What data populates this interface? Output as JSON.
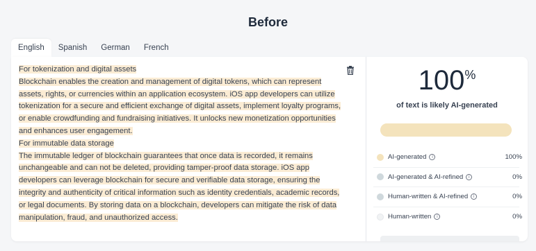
{
  "page": {
    "title": "Before"
  },
  "tabs": [
    {
      "label": "English",
      "active": true
    },
    {
      "label": "Spanish",
      "active": false
    },
    {
      "label": "German",
      "active": false
    },
    {
      "label": "French",
      "active": false
    }
  ],
  "content": {
    "paragraphs": [
      "For tokenization and digital assets",
      "Blockchain enables the creation and management of digital tokens, which can represent assets, rights, or currencies within an application ecosystem. iOS app developers can utilize tokenization for a secure and efficient exchange of digital assets, implement loyalty programs, or enable crowdfunding and fundraising initiatives. It unlocks new monetization opportunities and enhances user engagement.",
      "For immutable data storage",
      "The immutable ledger of blockchain guarantees that once data is recorded, it remains unchangeable and can not be deleted, providing tamper-proof data storage. iOS app developers can leverage blockchain for secure and verifiable data storage, ensuring the integrity and authenticity of critical information such as identity credentials, academic records, or legal documents. By storing data on a blockchain, developers can mitigate the risk of data manipulation, fraud, and unauthorized access."
    ],
    "delete_icon": "trash-icon"
  },
  "result": {
    "score": "100",
    "score_unit": "%",
    "score_label": "of text is likely AI-generated",
    "bar_fraction": 1.0,
    "bar_color": "#f4e3bc",
    "legend": [
      {
        "label": "AI-generated",
        "value": "100%",
        "color": "#f4e3bc"
      },
      {
        "label": "AI-generated & AI-refined",
        "value": "0%",
        "color": "#cfd8dc"
      },
      {
        "label": "Human-written & AI-refined",
        "value": "0%",
        "color": "#cfd8dc"
      },
      {
        "label": "Human-written",
        "value": "0%",
        "color": "#f1f3f4"
      }
    ],
    "info_icon": "info-icon"
  },
  "colors": {
    "highlight": "#fbecd4",
    "title": "#1e2a3b"
  }
}
